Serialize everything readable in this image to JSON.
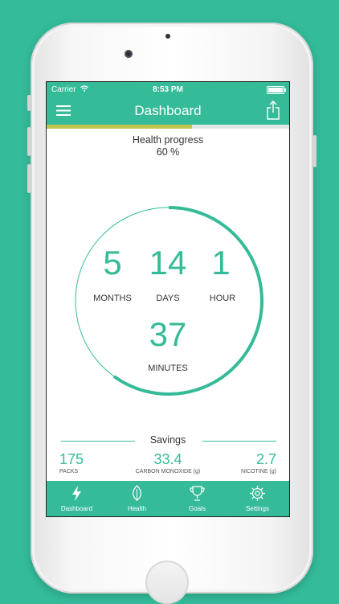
{
  "status_bar": {
    "carrier": "Carrier",
    "time": "8:53 PM"
  },
  "nav": {
    "title": "Dashboard"
  },
  "health_progress": {
    "label": "Health progress",
    "value_text": "60 %",
    "value": 0.6
  },
  "timer": {
    "months": {
      "value": "5",
      "label": "MONTHS"
    },
    "days": {
      "value": "14",
      "label": "DAYS"
    },
    "hours": {
      "value": "1",
      "label": "HOUR"
    },
    "minutes": {
      "value": "37",
      "label": "MINUTES"
    },
    "ring_progress": 0.6
  },
  "savings": {
    "title": "Savings",
    "items": [
      {
        "value": "175",
        "label": "PACKS"
      },
      {
        "value": "33.4",
        "label": "CARBON MONOXIDE (g)"
      },
      {
        "value": "2.7",
        "label": "NICOTINE (g)"
      }
    ]
  },
  "tabs": [
    {
      "label": "Dashboard",
      "icon": "lightning-icon",
      "active": true
    },
    {
      "label": "Health",
      "icon": "leaf-icon",
      "active": false
    },
    {
      "label": "Goals",
      "icon": "trophy-icon",
      "active": false
    },
    {
      "label": "Settings",
      "icon": "gear-icon",
      "active": false
    }
  ],
  "colors": {
    "accent": "#36bb99",
    "background": "#33bb9a",
    "progress_fill": "#bfc44f"
  }
}
